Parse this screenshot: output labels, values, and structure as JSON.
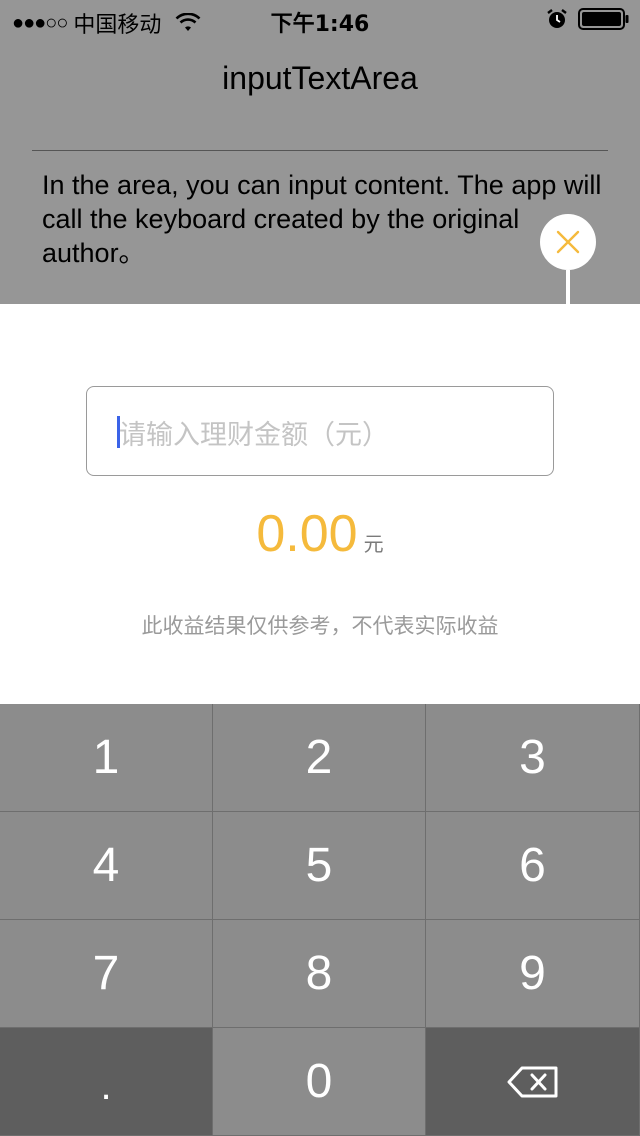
{
  "status_bar": {
    "signal_dots": "●●●○○",
    "carrier": "中国移动",
    "time": "下午1:46",
    "icons": [
      "wifi-icon",
      "alarm-icon",
      "battery-icon"
    ]
  },
  "nav": {
    "title": "inputTextArea"
  },
  "description": "In the area, you can input content. The app will call the keyboard created by the original author。",
  "close_button": {
    "icon": "close-icon",
    "color": "#F5BA3C"
  },
  "panel": {
    "input": {
      "value": "",
      "placeholder": "请输入理财金额（元）"
    },
    "result": {
      "value": "0.00",
      "unit": "元"
    },
    "disclaimer": "此收益结果仅供参考，不代表实际收益"
  },
  "keypad": {
    "keys": [
      "1",
      "2",
      "3",
      "4",
      "5",
      "6",
      "7",
      "8",
      "9",
      ".",
      "0"
    ],
    "delete_icon": "backspace-icon"
  },
  "colors": {
    "background": "#969696",
    "accent": "#F5BA3C",
    "cursor": "#3B63E8",
    "key": "#8C8C8C",
    "key_dark": "#5E5E5E"
  }
}
